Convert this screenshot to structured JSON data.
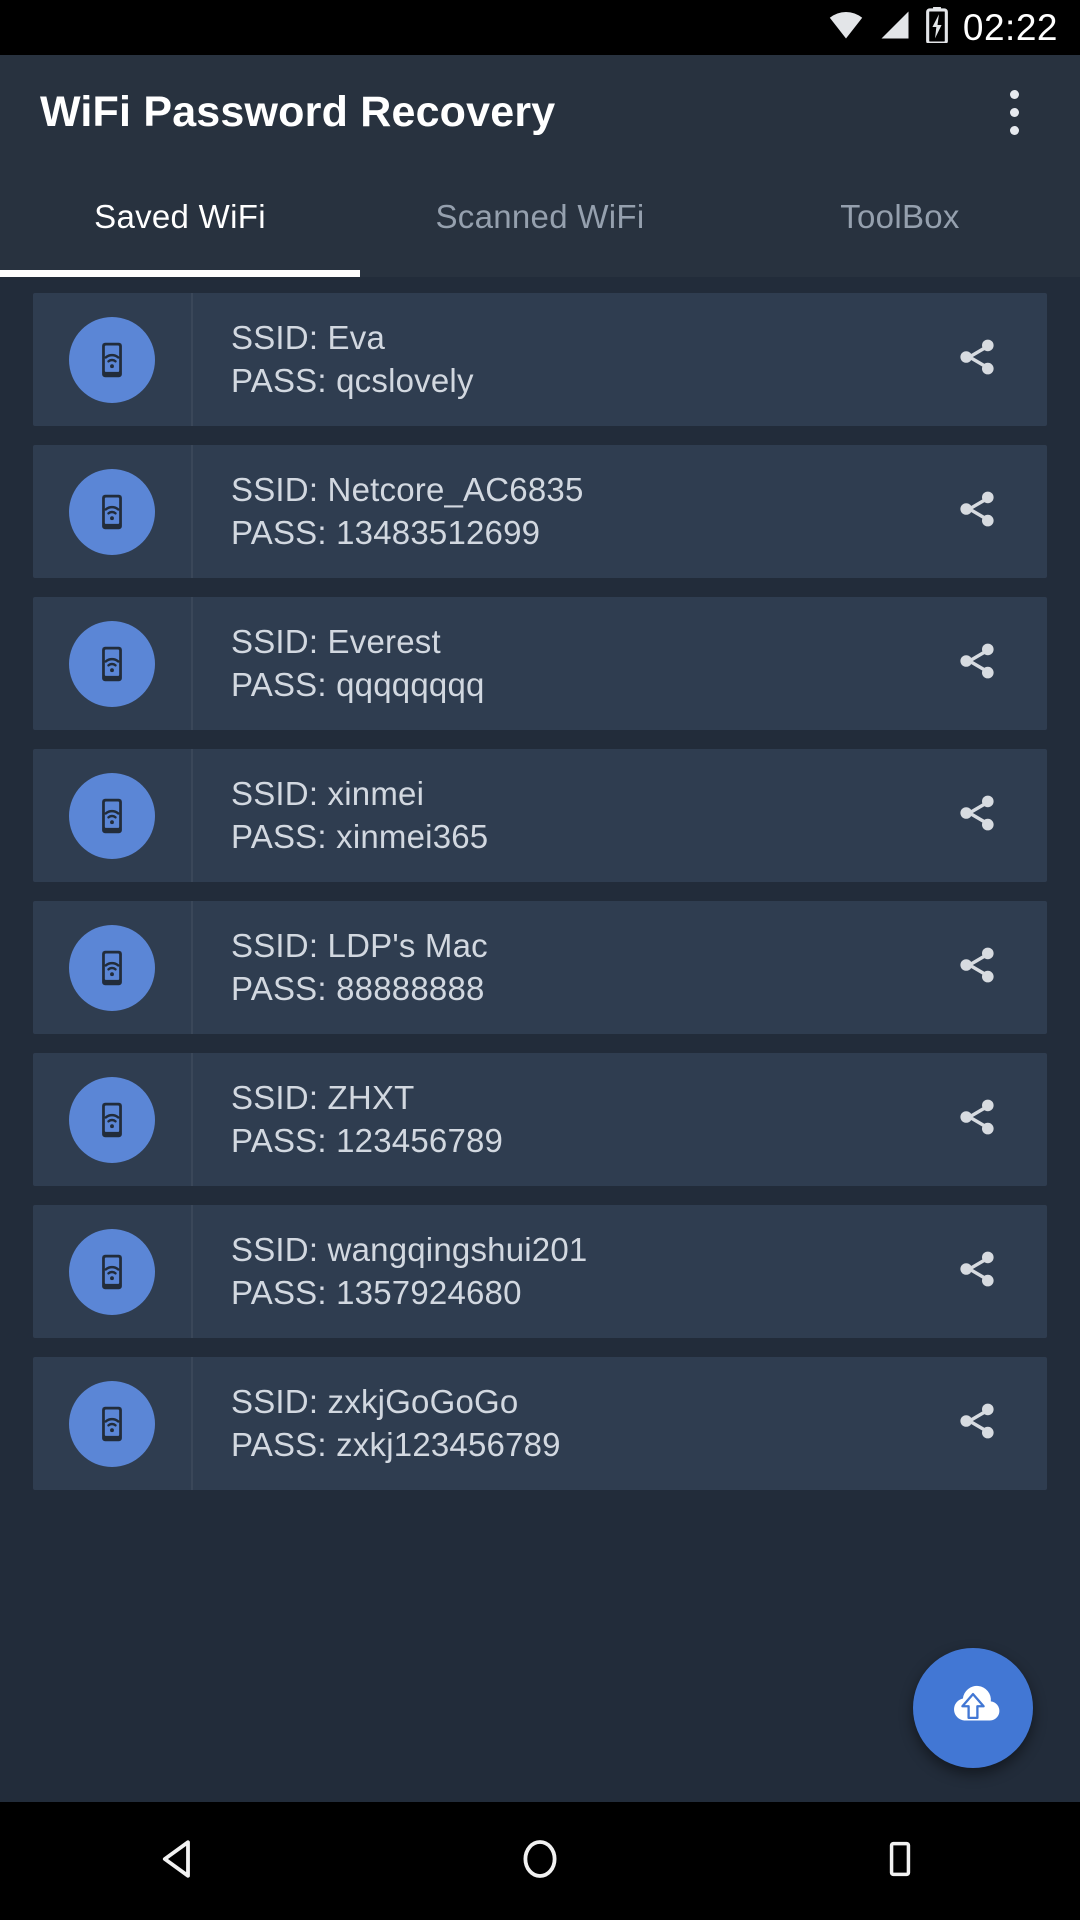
{
  "status_bar": {
    "time": "02:22",
    "icons": [
      "wifi-icon",
      "cellular-signal-icon",
      "battery-charging-icon"
    ]
  },
  "app_bar": {
    "title": "WiFi Password Recovery",
    "overflow_menu": "more-options-icon"
  },
  "tabs": {
    "active_index": 0,
    "items": [
      {
        "label": "Saved WiFi"
      },
      {
        "label": "Scanned WiFi"
      },
      {
        "label": "ToolBox"
      }
    ]
  },
  "list": {
    "ssid_prefix": "SSID: ",
    "pass_prefix": "PASS: ",
    "items": [
      {
        "ssid_line": "SSID:  Eva",
        "pass_line": "PASS:  qcslovely"
      },
      {
        "ssid_line": "SSID:  Netcore_AC6835",
        "pass_line": "PASS:  13483512699"
      },
      {
        "ssid_line": "SSID:  Everest",
        "pass_line": "PASS:  qqqqqqqq"
      },
      {
        "ssid_line": "SSID:  xinmei",
        "pass_line": "PASS:  xinmei365"
      },
      {
        "ssid_line": "SSID:  LDP's Mac",
        "pass_line": "PASS:  88888888"
      },
      {
        "ssid_line": "SSID:  ZHXT",
        "pass_line": "PASS:  123456789"
      },
      {
        "ssid_line": "SSID:  wangqingshui201",
        "pass_line": "PASS:  1357924680"
      },
      {
        "ssid_line": "SSID:  zxkjGoGoGo",
        "pass_line": "PASS:  zxkj123456789"
      }
    ]
  },
  "fab": {
    "icon": "cloud-upload-icon"
  },
  "nav_bar": {
    "back": "back-triangle-icon",
    "home": "home-circle-icon",
    "recents": "recents-square-icon"
  },
  "colors": {
    "background": "#222c3a",
    "appbar": "#28323f",
    "card": "#2f3d50",
    "accent_blue": "#4277d4",
    "icon_blue": "#5b86d6",
    "text_primary": "#ffffff",
    "text_secondary": "#d2d8e0",
    "text_muted": "#95a0ae"
  }
}
